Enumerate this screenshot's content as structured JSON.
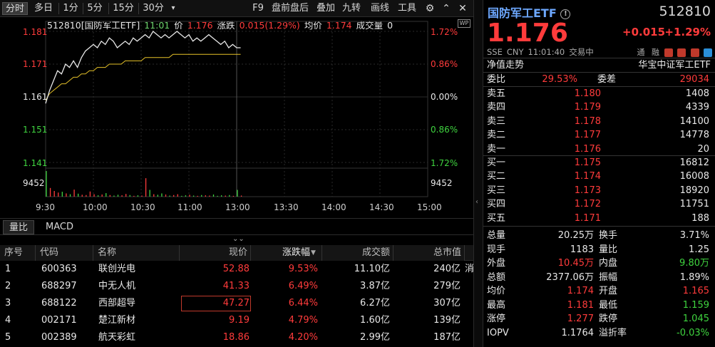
{
  "toolbar": {
    "left": [
      "分时",
      "多日",
      "1分",
      "5分",
      "15分",
      "30分"
    ],
    "right": [
      "F9",
      "盘前盘后",
      "叠加",
      "九转",
      "画线",
      "工具"
    ]
  },
  "info": {
    "code_name": "512810[国防军工ETF]",
    "time": "11:01",
    "price_label": "价",
    "price": "1.176",
    "change_label": "涨跌",
    "change": "0.015(1.29%)",
    "avg_label": "均价",
    "avg": "1.174",
    "volume_label": "成交量",
    "volume": "0"
  },
  "chart_data": {
    "type": "line",
    "y_left_ticks": [
      "1.181",
      "1.171",
      "1.161",
      "1.151",
      "1.141"
    ],
    "y_right_ticks": [
      "1.72%",
      "0.86%",
      "0.00%",
      "0.86%",
      "1.72%"
    ],
    "y_range": [
      1.138,
      1.184
    ],
    "prev_close": 1.161,
    "x_ticks": [
      "9:30",
      "10:00",
      "10:30",
      "11:00",
      "13:00",
      "13:30",
      "14:00",
      "14:30",
      "15:00"
    ],
    "volume_label_left": "9452",
    "volume_label_right": "9452",
    "price_series": [
      1.159,
      1.163,
      1.166,
      1.169,
      1.168,
      1.171,
      1.17,
      1.172,
      1.17,
      1.173,
      1.175,
      1.176,
      1.177,
      1.176,
      1.178,
      1.177,
      1.179,
      1.178,
      1.176,
      1.177,
      1.178,
      1.177,
      1.179,
      1.178,
      1.179,
      1.18,
      1.179,
      1.181,
      1.18,
      1.179,
      1.18,
      1.179,
      1.18,
      1.181,
      1.18,
      1.179,
      1.18,
      1.178,
      1.179,
      1.178,
      1.179,
      1.18,
      1.179,
      1.178,
      1.177,
      1.178,
      1.176,
      1.177,
      1.176,
      1.176
    ],
    "avg_series": [
      1.16,
      1.162,
      1.163,
      1.164,
      1.165,
      1.165,
      1.166,
      1.167,
      1.167,
      1.168,
      1.168,
      1.169,
      1.169,
      1.17,
      1.17,
      1.17,
      1.171,
      1.171,
      1.171,
      1.171,
      1.172,
      1.172,
      1.172,
      1.172,
      1.172,
      1.173,
      1.173,
      1.173,
      1.173,
      1.173,
      1.173,
      1.173,
      1.174,
      1.174,
      1.174,
      1.174,
      1.174,
      1.174,
      1.174,
      1.174,
      1.174,
      1.174,
      1.174,
      1.174,
      1.174,
      1.174,
      1.174,
      1.174,
      1.174,
      1.174
    ],
    "volume_series": [
      9452,
      3200,
      2100,
      1500,
      1800,
      1200,
      900,
      2600,
      1100,
      700,
      600,
      1900,
      900,
      500,
      800,
      1300,
      600,
      400,
      700,
      500,
      1000,
      600,
      300,
      500,
      400,
      6800,
      2500,
      900,
      700,
      1200,
      800,
      400,
      600,
      900,
      300,
      500,
      700,
      400,
      300,
      600,
      500,
      400,
      800,
      300,
      500,
      400,
      600,
      300,
      2500,
      400
    ]
  },
  "tabs": [
    "量比",
    "MACD"
  ],
  "table": {
    "headers": [
      "序号",
      "代码",
      "名称",
      "现价",
      "涨跌幅",
      "成交额",
      "总市值"
    ],
    "rows": [
      {
        "no": "1",
        "code": "600363",
        "name": "联创光电",
        "price": "52.88",
        "pct": "9.53%",
        "amount": "11.10亿",
        "cap": "240亿",
        "extra": "消"
      },
      {
        "no": "2",
        "code": "688297",
        "name": "中无人机",
        "price": "41.33",
        "pct": "6.49%",
        "amount": "3.87亿",
        "cap": "279亿",
        "extra": ""
      },
      {
        "no": "3",
        "code": "688122",
        "name": "西部超导",
        "price": "47.27",
        "pct": "6.44%",
        "amount": "6.27亿",
        "cap": "307亿",
        "extra": ""
      },
      {
        "no": "4",
        "code": "002171",
        "name": "楚江新材",
        "price": "9.19",
        "pct": "4.79%",
        "amount": "1.60亿",
        "cap": "139亿",
        "extra": ""
      },
      {
        "no": "5",
        "code": "002389",
        "name": "航天彩虹",
        "price": "18.86",
        "pct": "4.20%",
        "amount": "2.99亿",
        "cap": "187亿",
        "extra": ""
      }
    ]
  },
  "panel": {
    "title": "国防军工ETF",
    "code": "512810",
    "price": "1.176",
    "change": "+0.015",
    "pct": "+1.29%",
    "exchange": "SSE",
    "currency": "CNY",
    "time": "11:01:40",
    "status": "交易中",
    "tags": [
      "通",
      "融"
    ],
    "nav_label": "净值走势",
    "fund_name": "华宝中证军工ETF",
    "weibi_label": "委比",
    "weibi": "29.53%",
    "weicha_label": "委差",
    "weicha": "29034",
    "asks": [
      {
        "label": "卖五",
        "price": "1.180",
        "vol": "1408"
      },
      {
        "label": "卖四",
        "price": "1.179",
        "vol": "4339"
      },
      {
        "label": "卖三",
        "price": "1.178",
        "vol": "14100"
      },
      {
        "label": "卖二",
        "price": "1.177",
        "vol": "14778"
      },
      {
        "label": "卖一",
        "price": "1.176",
        "vol": "20"
      }
    ],
    "bids": [
      {
        "label": "买一",
        "price": "1.175",
        "vol": "16812"
      },
      {
        "label": "买二",
        "price": "1.174",
        "vol": "16008"
      },
      {
        "label": "买三",
        "price": "1.173",
        "vol": "18920"
      },
      {
        "label": "买四",
        "price": "1.172",
        "vol": "11751"
      },
      {
        "label": "买五",
        "price": "1.171",
        "vol": "188"
      }
    ],
    "stats": [
      {
        "l1": "总量",
        "v1": "20.25万",
        "l2": "换手",
        "v2": "3.71%",
        "c1": "white",
        "c2": "white"
      },
      {
        "l1": "现手",
        "v1": "1183",
        "l2": "量比",
        "v2": "1.25",
        "c1": "white",
        "c2": "white"
      },
      {
        "l1": "外盘",
        "v1": "10.45万",
        "l2": "内盘",
        "v2": "9.80万",
        "c1": "red",
        "c2": "green"
      },
      {
        "l1": "总额",
        "v1": "2377.06万",
        "l2": "振幅",
        "v2": "1.89%",
        "c1": "white",
        "c2": "white"
      },
      {
        "l1": "均价",
        "v1": "1.174",
        "l2": "开盘",
        "v2": "1.165",
        "c1": "red",
        "c2": "red"
      },
      {
        "l1": "最高",
        "v1": "1.181",
        "l2": "最低",
        "v2": "1.159",
        "c1": "red",
        "c2": "green"
      },
      {
        "l1": "涨停",
        "v1": "1.277",
        "l2": "跌停",
        "v2": "1.045",
        "c1": "red",
        "c2": "green"
      },
      {
        "l1": "IOPV",
        "v1": "1.1764",
        "l2": "溢折率",
        "v2": "-0.03%",
        "c1": "white",
        "c2": "green"
      }
    ],
    "colors": {
      "up": "#ff3b3b",
      "down": "#3fd43f",
      "title": "#6da8ff",
      "avg_line": "#e6c229"
    }
  }
}
